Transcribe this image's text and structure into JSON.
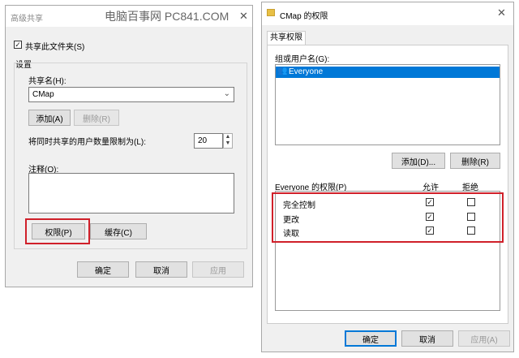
{
  "left_dialog": {
    "title": "高级共享",
    "watermark": "电脑百事网 PC841.COM",
    "share_folder_checkbox": "共享此文件夹(S)",
    "settings_group": "设置",
    "share_name_label": "共享名(H):",
    "share_name_value": "CMap",
    "add_button": "添加(A)",
    "remove_button": "删除(R)",
    "user_limit_label": "将同时共享的用户数量限制为(L):",
    "user_limit_value": "20",
    "comment_label": "注释(O):",
    "permissions_button": "权限(P)",
    "cache_button": "缓存(C)",
    "ok_button": "确定",
    "cancel_button": "取消",
    "apply_button": "应用"
  },
  "right_dialog": {
    "title": "CMap 的权限",
    "tab_share_permissions": "共享权限",
    "group_label": "组或用户名(G):",
    "users": [
      "Everyone"
    ],
    "add_button": "添加(D)...",
    "remove_button": "删除(R)",
    "permissions_label": "Everyone 的权限(P)",
    "allow_header": "允许",
    "deny_header": "拒绝",
    "permissions": [
      {
        "name": "完全控制",
        "allow": true,
        "deny": false
      },
      {
        "name": "更改",
        "allow": true,
        "deny": false
      },
      {
        "name": "读取",
        "allow": true,
        "deny": false
      }
    ],
    "ok_button": "确定",
    "cancel_button": "取消",
    "apply_button": "应用(A)"
  },
  "colors": {
    "highlight": "#0078d7",
    "annotation": "#d0202a"
  }
}
